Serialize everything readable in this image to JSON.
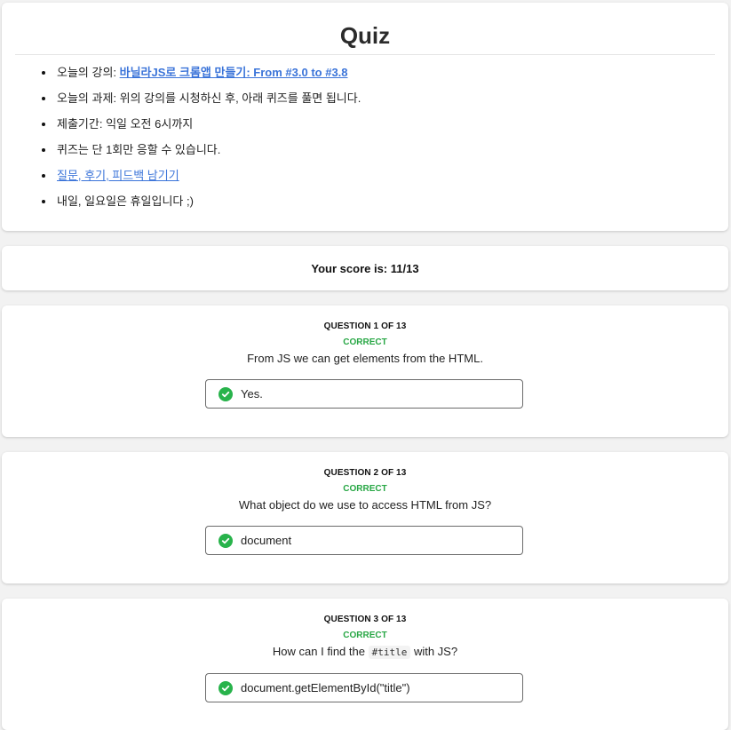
{
  "header": {
    "title": "Quiz",
    "items": [
      {
        "label": "오늘의 강의: ",
        "link": "바닐라JS로 크롬앱 만들기: From #3.0 to #3.8"
      },
      {
        "label": "오늘의 과제: 위의 강의를 시청하신 후, 아래 퀴즈를 풀면 됩니다."
      },
      {
        "label": "제출기간: 익일 오전 6시까지"
      },
      {
        "label": "퀴즈는 단 1회만 응할 수 있습니다."
      },
      {
        "link": "질문, 후기, 피드백 남기기"
      },
      {
        "label": "내일, 일요일은 휴일입니다 ;)"
      }
    ]
  },
  "score": {
    "text": "Your score is: 11/13"
  },
  "questions": [
    {
      "heading": "QUESTION 1 OF 13",
      "status": "CORRECT",
      "prompt": "From JS we can get elements from the HTML.",
      "answer": "Yes."
    },
    {
      "heading": "QUESTION 2 OF 13",
      "status": "CORRECT",
      "prompt": "What object do we use to access HTML from JS?",
      "answer": "document"
    },
    {
      "heading": "QUESTION 3 OF 13",
      "status": "CORRECT",
      "prompt_before": "How can I find the ",
      "prompt_code": "#title",
      "prompt_after": " with JS?",
      "answer": "document.getElementById(\"title\")"
    }
  ],
  "icons": {
    "answer_status": "check-circle-icon"
  },
  "colors": {
    "correct": "#28a745",
    "link": "#3b74d9",
    "check": "#28b34b"
  }
}
